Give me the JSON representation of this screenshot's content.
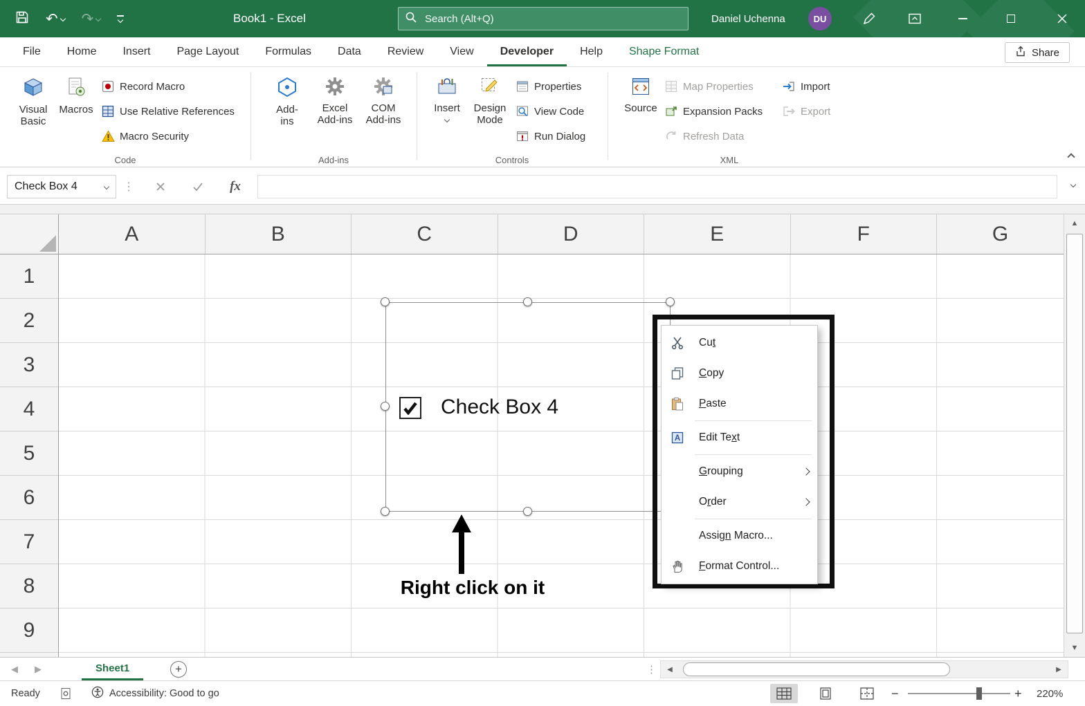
{
  "titlebar": {
    "title": "Book1 - Excel",
    "search_placeholder": "Search (Alt+Q)",
    "user_name": "Daniel Uchenna",
    "user_initials": "DU"
  },
  "tabs": {
    "file": "File",
    "home": "Home",
    "insert": "Insert",
    "page_layout": "Page Layout",
    "formulas": "Formulas",
    "data": "Data",
    "review": "Review",
    "view": "View",
    "developer": "Developer",
    "help": "Help",
    "shape_format": "Shape Format",
    "share": "Share"
  },
  "ribbon": {
    "code": {
      "group_name": "Code",
      "visual_basic": "Visual Basic",
      "macros": "Macros",
      "record_macro": "Record Macro",
      "use_relative_references": "Use Relative References",
      "macro_security": "Macro Security"
    },
    "addins": {
      "group_name": "Add-ins",
      "addins": "Add-ins",
      "excel_addins": "Excel Add-ins",
      "com_addins": "COM Add-ins"
    },
    "controls": {
      "group_name": "Controls",
      "insert": "Insert",
      "design_mode": "Design Mode",
      "properties": "Properties",
      "view_code": "View Code",
      "run_dialog": "Run Dialog"
    },
    "xml": {
      "group_name": "XML",
      "source": "Source",
      "map_properties": "Map Properties",
      "expansion_packs": "Expansion Packs",
      "refresh_data": "Refresh Data",
      "import": "Import",
      "export": "Export"
    }
  },
  "formula_bar": {
    "name_box_value": "Check Box 4",
    "fx_label": "fx"
  },
  "grid": {
    "columns": [
      "A",
      "B",
      "C",
      "D",
      "E",
      "F",
      "G"
    ],
    "rows": [
      "1",
      "2",
      "3",
      "4",
      "5",
      "6",
      "7",
      "8",
      "9"
    ]
  },
  "canvas": {
    "checkbox_label": "Check Box 4",
    "annotation_text": "Right click on it"
  },
  "context_menu": {
    "cut": {
      "pre": "Cu",
      "u": "t",
      "post": ""
    },
    "copy": {
      "pre": "",
      "u": "C",
      "post": "opy"
    },
    "paste": {
      "pre": "",
      "u": "P",
      "post": "aste"
    },
    "edit_text": {
      "pre": "Edit Te",
      "u": "x",
      "post": "t"
    },
    "grouping": {
      "pre": "",
      "u": "G",
      "post": "rouping"
    },
    "order": {
      "pre": "O",
      "u": "r",
      "post": "der"
    },
    "assign_macro": {
      "pre": "Assig",
      "u": "n",
      "post": " Macro..."
    },
    "format_control": {
      "pre": "",
      "u": "F",
      "post": "ormat Control..."
    }
  },
  "sheet_bar": {
    "sheet1": "Sheet1"
  },
  "status_bar": {
    "ready": "Ready",
    "accessibility": "Accessibility: Good to go",
    "zoom_out": "−",
    "zoom_in": "+",
    "zoom_level": "220%"
  },
  "colors": {
    "excel_green": "#217346",
    "avatar_purple": "#7a4fa2",
    "disabled_text": "#a19f9d"
  }
}
